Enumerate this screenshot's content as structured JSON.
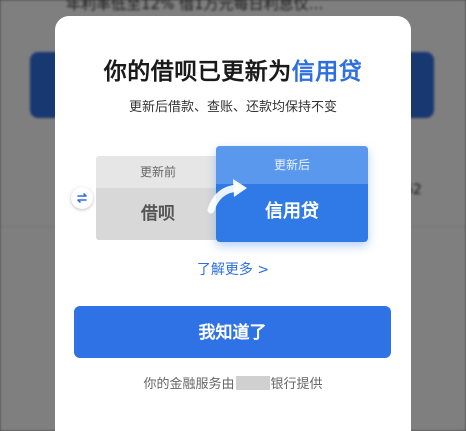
{
  "background": {
    "top_text": "年利率低至12%   借1万元每日利息仅…",
    "right_number": "62"
  },
  "modal": {
    "title_prefix": "你的借呗已更新为",
    "title_accent": "信用贷",
    "subtitle": "更新后借款、查账、还款均保持不变",
    "before": {
      "label": "更新前",
      "name": "借呗"
    },
    "after": {
      "label": "更新后",
      "name": "信用贷"
    },
    "learn_more": "了解更多",
    "learn_more_chevron": ">",
    "confirm_label": "我知道了",
    "footer_prefix": "你的金融服务由",
    "footer_suffix": "银行提供"
  },
  "colors": {
    "accent": "#2d6fe0",
    "button": "#2f72e6"
  },
  "icons": [
    "switch-icon",
    "curved-arrow-icon",
    "chevron-right-icon"
  ]
}
